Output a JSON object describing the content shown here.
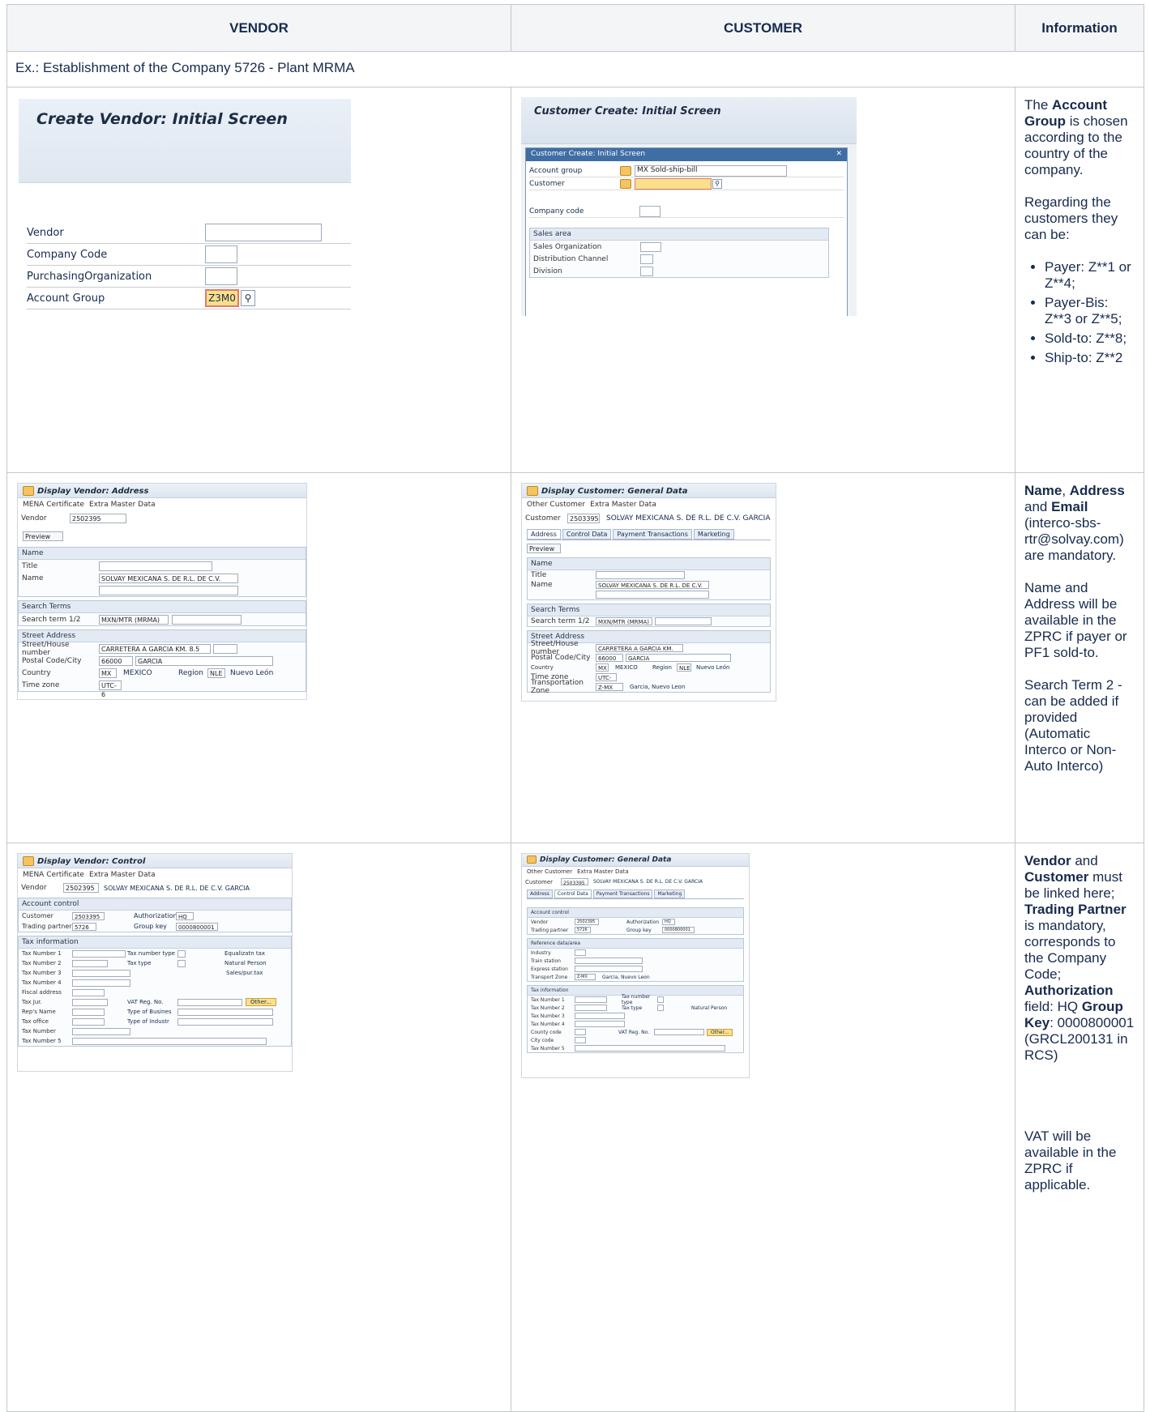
{
  "headers": {
    "vendor": "VENDOR",
    "customer": "CUSTOMER",
    "information": "Information"
  },
  "example": "Ex.: Establishment of the Company 5726 - Plant MRMA",
  "vendor_initial": {
    "title": "Create Vendor:  Initial Screen",
    "fields": [
      "Vendor",
      "Company Code",
      "PurchasingOrganization",
      "Account Group"
    ],
    "account_group_value": "Z3M0"
  },
  "customer_initial": {
    "title": "Customer Create: Initial Screen",
    "dialog_title": "Customer Create: Initial Screen",
    "account_group_label": "Account group",
    "account_group_value": "MX Sold-ship-bill",
    "customer_label": "Customer",
    "company_code_label": "Company code",
    "sales_area_label": "Sales area",
    "sales_fields": [
      "Sales Organization",
      "Distribution Channel",
      "Division"
    ]
  },
  "vendor_address": {
    "title": "Display Vendor: Address",
    "toolbar": [
      "MENA Certificate",
      "Extra Master Data"
    ],
    "vendor_label": "Vendor",
    "vendor_value": "2502395",
    "preview": "Preview",
    "name_group": "Name",
    "title_label": "Title",
    "name_label": "Name",
    "name_value": "SOLVAY MEXICANA S. DE R.L. DE C.V.",
    "search_group": "Search Terms",
    "search_label": "Search term 1/2",
    "search_value": "MXN/MTR (MRMA)",
    "street_group": "Street Address",
    "street_label": "Street/House number",
    "street_value": "CARRETERA A GARCIA KM. 8.5",
    "postal_label": "Postal Code/City",
    "postal_value": "66000",
    "city_value": "GARCIA",
    "country_label": "Country",
    "country_code": "MX",
    "country_name": "MEXICO",
    "region_label": "Region",
    "region_code": "NLE",
    "region_name": "Nuevo León",
    "tz_label": "Time zone",
    "tz_value": "UTC-6"
  },
  "customer_general": {
    "title": "Display Customer: General Data",
    "toolbar": [
      "Other Customer",
      "Extra Master Data"
    ],
    "customer_label": "Customer",
    "customer_value": "2503395",
    "customer_name": "SOLVAY MEXICANA S. DE R.L. DE C.V.   GARCIA",
    "tabs": [
      "Address",
      "Control Data",
      "Payment Transactions",
      "Marketing"
    ],
    "transport_label": "Transportation Zone",
    "transport_value": "Z-MX",
    "transport_name": "Garcia, Nuevo Leon",
    "tz_value": "UTC-6"
  },
  "vendor_control": {
    "title": "Display Vendor: Control",
    "vendor_value": "2502395",
    "vendor_name": "SOLVAY MEXICANA S. DE R.L. DE C.V.  GARCIA",
    "account_group": "Account control",
    "customer_label": "Customer",
    "customer_value": "2503395",
    "auth_label": "Authorization",
    "auth_value": "HQ",
    "tp_label": "Trading partner",
    "tp_value": "5726",
    "gk_label": "Group key",
    "gk_value": "0000800001",
    "tax_group": "Tax information",
    "tax_rows": [
      "Tax Number 1",
      "Tax Number 2",
      "Tax Number 3",
      "Tax Number 4",
      "Fiscal address",
      "Tax Jur.",
      "Rep's Name",
      "Tax office",
      "Tax Number",
      "Tax Number 5"
    ],
    "tax_right": [
      "Tax number type",
      "Tax type",
      "",
      "",
      "",
      "VAT Reg. No.",
      "Type of Busines",
      "Type of Industr"
    ],
    "checks": [
      "Equalizatn tax",
      "Natural Person",
      "Sales/pur.tax"
    ],
    "other": "Other..."
  },
  "customer_control": {
    "title": "Display Customer: General Data",
    "account_group": "Account control",
    "vendor_label": "Vendor",
    "vendor_value": "2502395",
    "auth_label": "Authorization",
    "auth_value": "HQ",
    "tp_label": "Trading partner",
    "tp_value": "5726",
    "gk_label": "Group key",
    "gk_value": "0000800001",
    "ref_group": "Reference data/area",
    "ref_rows": [
      "Industry",
      "Train station",
      "Express station",
      "Transport Zone"
    ],
    "tax_group": "Tax information",
    "tax_rows": [
      "Tax Number 1",
      "Tax Number 2",
      "Tax Number 3",
      "Tax Number 4",
      "County code",
      "City code",
      "Tax Number 5"
    ]
  },
  "info": {
    "r1_p1": [
      "The ",
      "Account Group",
      " is chosen according to the country of the company."
    ],
    "r1_p2": "Regarding the customers they can be:",
    "r1_list": [
      "Payer: Z**1 or Z**4;",
      "Payer-Bis: Z**3 or Z**5;",
      "Sold-to: Z**8;",
      "Ship-to: Z**2"
    ],
    "r2_p1": [
      "Name",
      ", ",
      "Address",
      " and ",
      "Email",
      " (interco-sbs-rtr@solvay.com) are mandatory."
    ],
    "r2_p2": "Name and Address will be available in the ZPRC if payer or PF1 sold-to.",
    "r2_p3": "Search Term 2 - can be added if provided (Automatic Interco or Non-Auto Interco)",
    "r3_p1": [
      "Vendor",
      " and ",
      "Customer",
      " must be linked here; ",
      "Trading Partner",
      " is mandatory, corresponds to the Company Code; ",
      "Authorization",
      " field: HQ ",
      "Group Key",
      ": 0000800001 (GRCL200131 in RCS)"
    ],
    "r3_p2": "VAT will be available in the ZPRC if applicable."
  }
}
